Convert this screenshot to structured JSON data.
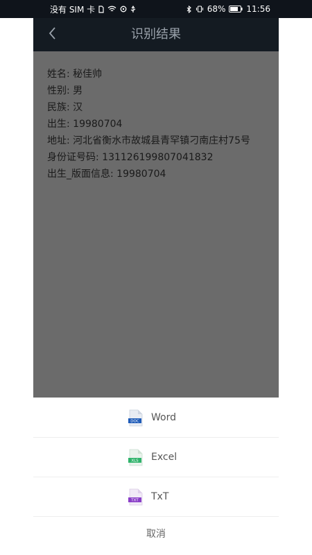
{
  "status_bar": {
    "carrier": "没有 SIM 卡",
    "battery": "68%",
    "time": "11:56"
  },
  "header": {
    "title": "识别结果"
  },
  "result": {
    "fields": [
      "姓名: 秘佳帅",
      "性别: 男",
      "民族: 汉",
      "出生: 19980704",
      "地址: 河北省衡水市故城县青罕镇刁南庄村75号",
      "身份证号码: 131126199807041832",
      "出生_版面信息: 19980704"
    ]
  },
  "export_sheet": {
    "options": [
      {
        "label": "Word",
        "badge": "DOC",
        "color": "#1e5bb8"
      },
      {
        "label": "Excel",
        "badge": "XLS",
        "color": "#2fb36b"
      },
      {
        "label": "TxT",
        "badge": "TXT",
        "color": "#8a3fc8"
      }
    ],
    "cancel": "取消"
  }
}
